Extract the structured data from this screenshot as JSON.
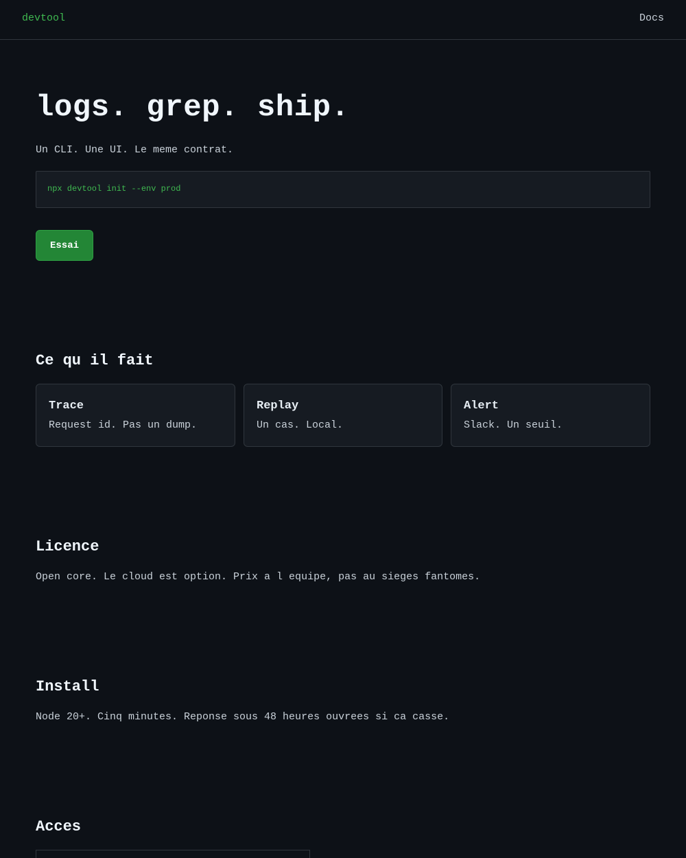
{
  "header": {
    "brand": "devtool",
    "nav_docs": "Docs"
  },
  "hero": {
    "title": "logs. grep. ship.",
    "subtitle": "Un CLI. Une UI. Le meme contrat.",
    "command": "npx devtool init --env prod",
    "cta_label": "Essai"
  },
  "features": {
    "heading": "Ce qu il fait",
    "cards": [
      {
        "title": "Trace",
        "desc": "Request id. Pas un dump."
      },
      {
        "title": "Replay",
        "desc": "Un cas. Local."
      },
      {
        "title": "Alert",
        "desc": "Slack. Un seuil."
      }
    ]
  },
  "license": {
    "heading": "Licence",
    "text": "Open core. Le cloud est option. Prix a l equipe, pas au sieges fantomes."
  },
  "install": {
    "heading": "Install",
    "text": "Node 20+. Cinq minutes. Reponse sous 48 heures ouvrees si ca casse."
  },
  "access": {
    "heading": "Acces"
  }
}
